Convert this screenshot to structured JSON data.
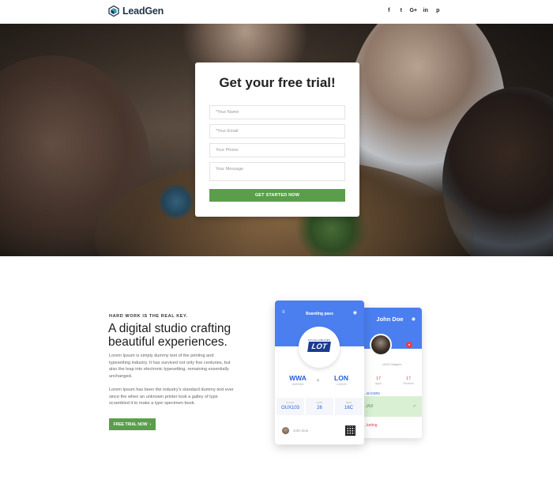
{
  "header": {
    "brand": "LeadGen",
    "social": [
      {
        "icon": "facebook-icon",
        "glyph": "f"
      },
      {
        "icon": "twitter-icon",
        "glyph": "t"
      },
      {
        "icon": "google-plus-icon",
        "glyph": "G+"
      },
      {
        "icon": "linkedin-icon",
        "glyph": "in"
      },
      {
        "icon": "pinterest-icon",
        "glyph": "p"
      }
    ]
  },
  "trial_form": {
    "title": "Get your free trial!",
    "name_placeholder": "*Your Name",
    "email_placeholder": "*Your Email",
    "phone_placeholder": "Your Phone",
    "message_placeholder": "Your Message",
    "submit_label": "GET STARTED NOW"
  },
  "intro": {
    "eyebrow": "HARD WORK IS THE REAL KEY.",
    "headline": "A digital studio crafting beautiful experiences.",
    "paragraph_1": "Lorem Ipsum is simply dummy text of the printing and typesetting industry. It has survived not only five centuries, but also the leap into electronic typesetting, remaining essentially unchanged.",
    "paragraph_2": "Lorem Ipsum has been the industry's standard dummy text ever since the when an unknown printer took a galley of type scrambled it to make a type specimen book.",
    "cta_label": "FREE TRIAL NOW",
    "cta_arrow": "›"
  },
  "mockup_front": {
    "menu_glyph": "≡",
    "title": "Boarding pass",
    "eye_glyph": "◉",
    "airline_sub": "POLISH AIRLINES",
    "airline_logo": "LOT",
    "from_code": "WWA",
    "from_city": "WARSAW",
    "to_code": "LON",
    "to_city": "LONDON",
    "plane_glyph": "✈",
    "tiles": [
      {
        "label": "FLIGHT",
        "value": "OUX103"
      },
      {
        "label": "GATE",
        "value": "26"
      },
      {
        "label": "SEAT",
        "value": "16C"
      }
    ],
    "user_name": "John Doe"
  },
  "mockup_back": {
    "name": "John Doe",
    "eye_glyph": "◉",
    "role": "UI/UX Designer",
    "rec_glyph": "●",
    "stats": [
      {
        "value": "17",
        "label": "Apps"
      },
      {
        "value": "17",
        "label": "Reviews"
      }
    ],
    "rows": [
      {
        "text": "...w icons"
      },
      {
        "text": "...I/UI"
      },
      {
        "text": "...keting"
      }
    ],
    "row_check": "✓"
  },
  "colors": {
    "accent_green": "#5a9e4b",
    "accent_blue": "#4b7ff0",
    "accent_red": "#ef3b4d"
  }
}
